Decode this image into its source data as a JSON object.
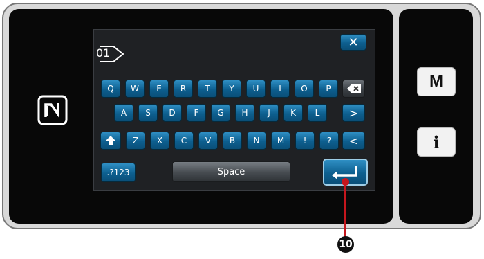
{
  "text_field": {
    "memory_number": "01",
    "value": ""
  },
  "keyboard": {
    "row1": [
      "Q",
      "W",
      "E",
      "R",
      "T",
      "Y",
      "U",
      "I",
      "O",
      "P"
    ],
    "row2": [
      "A",
      "S",
      "D",
      "F",
      "G",
      "H",
      "J",
      "K",
      "L"
    ],
    "row3": [
      "Z",
      "X",
      "C",
      "V",
      "B",
      "N",
      "M",
      "!",
      "?"
    ],
    "arrow_right": ">",
    "arrow_left": "<",
    "mode_label": ".?123",
    "space_label": "Space",
    "close_label": "✕"
  },
  "side_buttons": {
    "m_label": "M",
    "i_label": "i"
  },
  "callout": {
    "label": "10"
  },
  "icons": {
    "nfc": "nfc-icon",
    "backspace": "backspace-icon",
    "shift": "shift-icon",
    "enter": "enter-icon",
    "memory": "pattern-memory-icon"
  }
}
